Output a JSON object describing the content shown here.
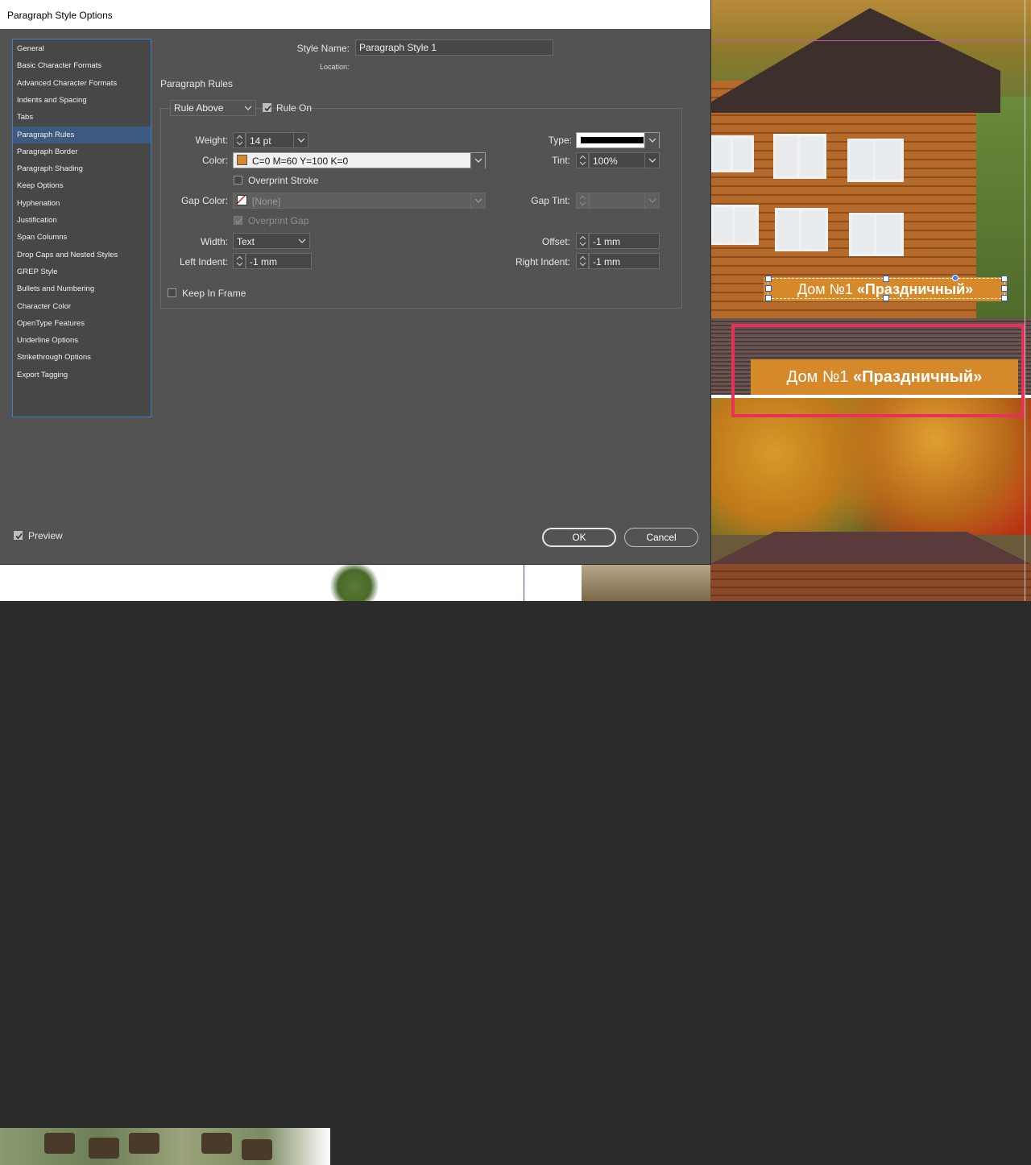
{
  "dialog": {
    "title": "Paragraph Style Options",
    "style_name_label": "Style Name:",
    "style_name_value": "Paragraph Style 1",
    "location_label": "Location:",
    "section_title": "Paragraph Rules",
    "rule_select": "Rule Above",
    "rule_on_label": "Rule On",
    "weight_label": "Weight:",
    "weight_value": "14 pt",
    "type_label": "Type:",
    "color_label": "Color:",
    "color_value": "C=0 M=60 Y=100 K=0",
    "tint_label": "Tint:",
    "tint_value": "100%",
    "overprint_stroke_label": "Overprint Stroke",
    "gap_color_label": "Gap Color:",
    "gap_color_value": "[None]",
    "gap_tint_label": "Gap Tint:",
    "overprint_gap_label": "Overprint Gap",
    "width_label": "Width:",
    "width_value": "Text",
    "offset_label": "Offset:",
    "offset_value": "-1 mm",
    "left_indent_label": "Left Indent:",
    "left_indent_value": "-1 mm",
    "right_indent_label": "Right Indent:",
    "right_indent_value": "-1 mm",
    "keep_in_frame_label": "Keep In Frame",
    "preview_label": "Preview",
    "ok_label": "OK",
    "cancel_label": "Cancel",
    "color_swatch": "#d5892a"
  },
  "sidebar": {
    "items": [
      "General",
      "Basic Character Formats",
      "Advanced Character Formats",
      "Indents and Spacing",
      "Tabs",
      "Paragraph Rules",
      "Paragraph Border",
      "Paragraph Shading",
      "Keep Options",
      "Hyphenation",
      "Justification",
      "Span Columns",
      "Drop Caps and Nested Styles",
      "GREP Style",
      "Bullets and Numbering",
      "Character Color",
      "OpenType Features",
      "Underline Options",
      "Strikethrough Options",
      "Export Tagging"
    ],
    "active_index": 5
  },
  "canvas": {
    "banner_small_prefix": "Дом №1 ",
    "banner_small_bold": "«Праздничный»",
    "banner_big_prefix": "Дом №1 ",
    "banner_big_bold": "«Праздничный»",
    "accent": "#d5892a",
    "highlight_color": "#e8305a"
  }
}
